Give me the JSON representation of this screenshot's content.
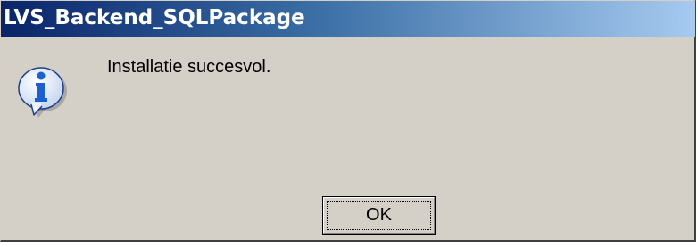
{
  "window": {
    "title": "LVS_Backend_SQLPackage"
  },
  "dialog": {
    "icon": "information-icon",
    "message": "Installatie succesvol.",
    "ok_label": "OK"
  },
  "colors": {
    "titlebar_start": "#0a246a",
    "titlebar_end": "#a6caf0",
    "dialog_background": "#d4d0c8",
    "icon_blue": "#1c5fd0"
  }
}
